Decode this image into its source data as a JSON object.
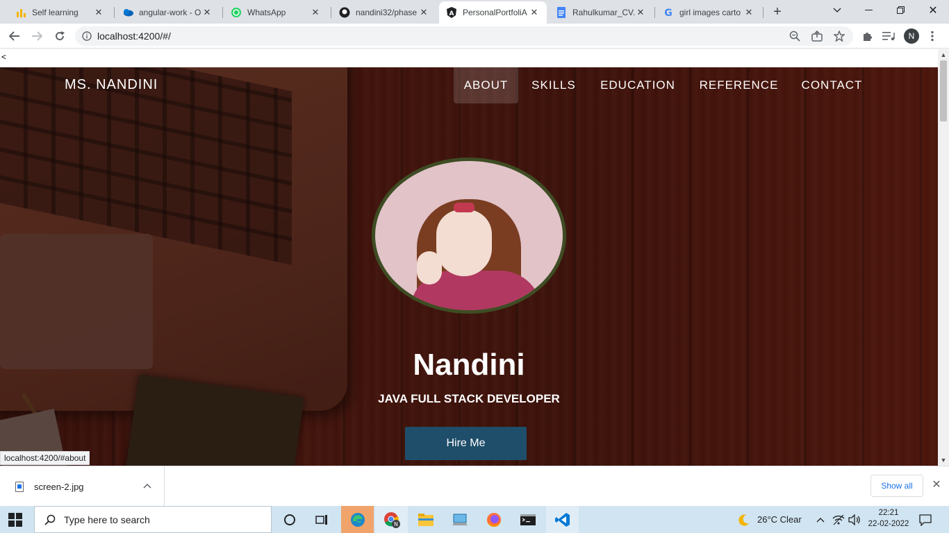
{
  "browser": {
    "tabs": [
      {
        "title": "Self learning",
        "icon": "yellow-bars-icon"
      },
      {
        "title": "angular-work - O",
        "icon": "cloud-icon"
      },
      {
        "title": "WhatsApp",
        "icon": "whatsapp-icon"
      },
      {
        "title": "nandini32/phase",
        "icon": "github-icon"
      },
      {
        "title": "PersonalPortfoliA",
        "icon": "angular-icon",
        "active": true
      },
      {
        "title": "Rahulkumar_CV.d",
        "icon": "docs-icon"
      },
      {
        "title": "girl images carto",
        "icon": "google-icon"
      }
    ],
    "address": "localhost:4200/#/",
    "profile_initial": "N"
  },
  "page": {
    "stray_text": "<",
    "brand": "MS. NANDINI",
    "nav": [
      {
        "label": "ABOUT",
        "active": true
      },
      {
        "label": "SKILLS"
      },
      {
        "label": "EDUCATION"
      },
      {
        "label": "REFERENCE"
      },
      {
        "label": "CONTACT"
      }
    ],
    "name": "Nandini",
    "role": "JAVA FULL STACK DEVELOPER",
    "hire_button": "Hire Me",
    "status_url": "localhost:4200/#about"
  },
  "downloads": {
    "file": "screen-2.jpg",
    "show_all": "Show all"
  },
  "taskbar": {
    "search_placeholder": "Type here to search",
    "weather": "26°C  Clear",
    "time": "22:21",
    "date": "22-02-2022"
  },
  "colors": {
    "hero_bg": "#4d1810",
    "hire_button": "#1f4e6b",
    "avatar_border": "#3e4c23",
    "taskbar": "#d0e4f1"
  }
}
